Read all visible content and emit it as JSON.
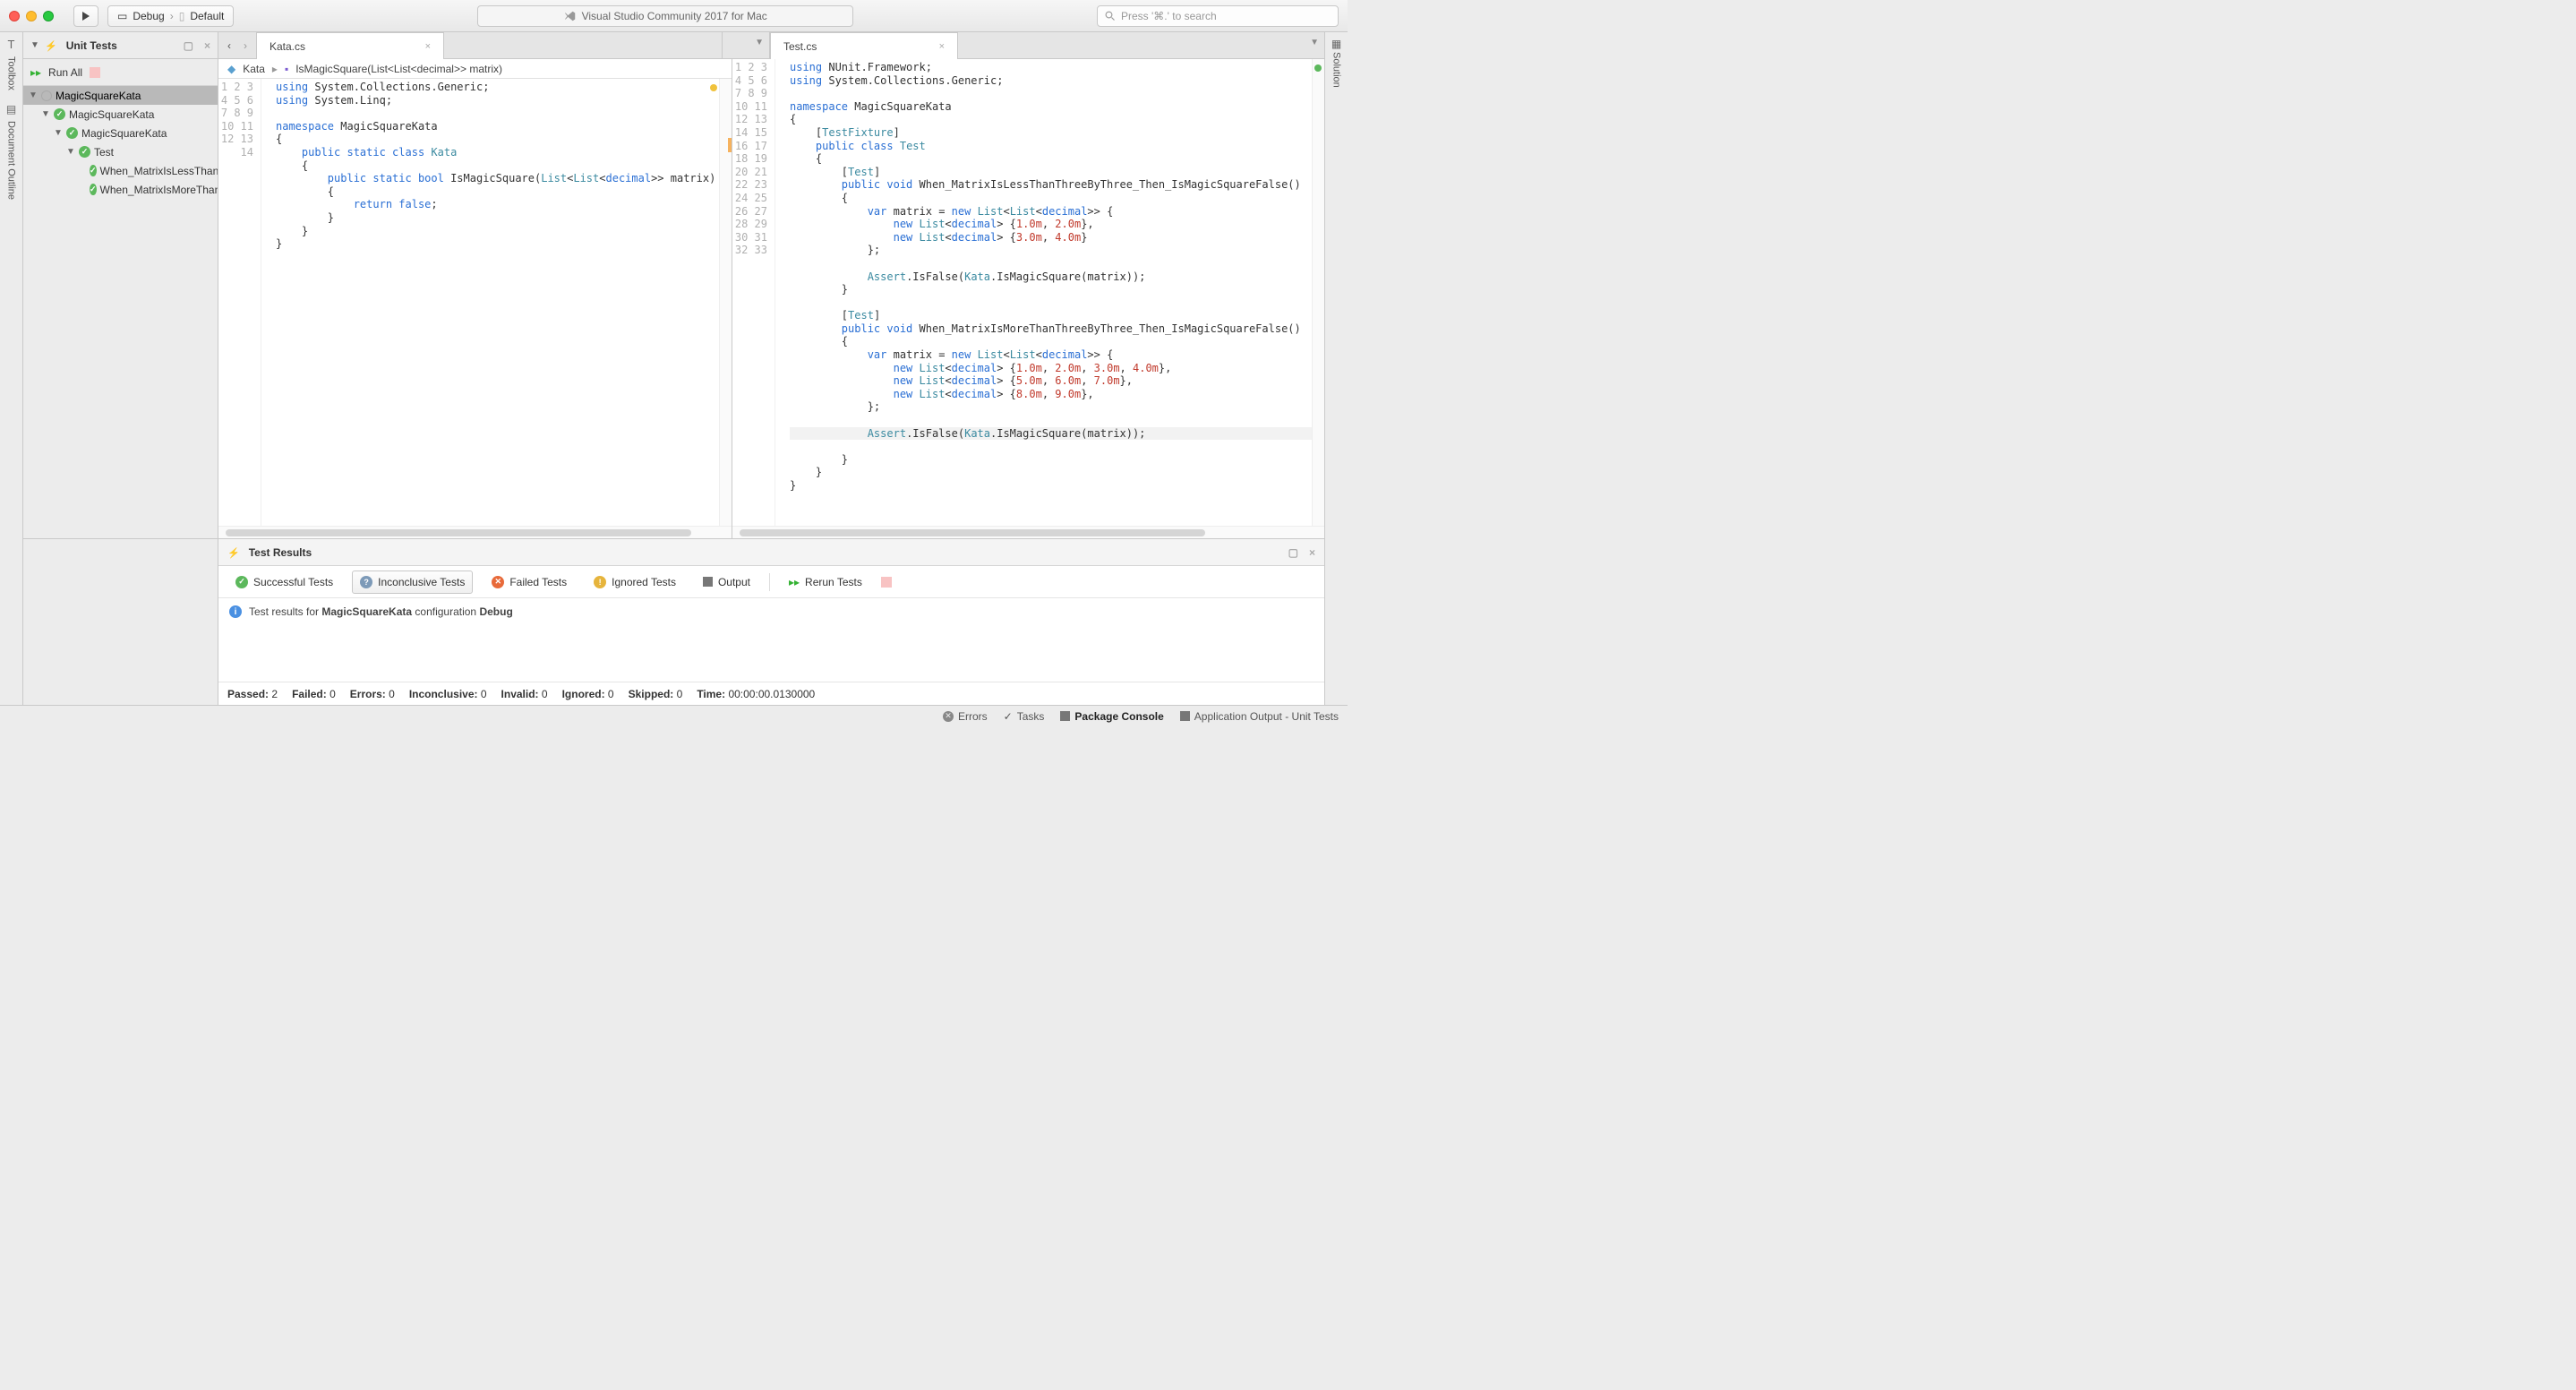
{
  "titlebar": {
    "config": "Debug",
    "target": "Default",
    "app_title": "Visual Studio Community 2017 for Mac",
    "search_placeholder": "Press '⌘.' to search"
  },
  "left_rail": {
    "toolbox": "Toolbox",
    "outline": "Document Outline"
  },
  "right_rail": {
    "solution": "Solution"
  },
  "unit_tests": {
    "title": "Unit Tests",
    "run_all": "Run All",
    "tree": {
      "root": "MagicSquareKata",
      "n0": "MagicSquareKata",
      "n1": "MagicSquareKata",
      "n2": "Test",
      "t1": "When_MatrixIsLessThanThreeByThree_Then_IsMagicSquareFalse",
      "t2": "When_MatrixIsMoreThanThreeByThree_Then_IsMagicSquareFalse"
    }
  },
  "tabs": {
    "left": "Kata.cs",
    "right": "Test.cs"
  },
  "crumb": {
    "c1": "Kata",
    "c2": "IsMagicSquare(List<List<decimal>> matrix)"
  },
  "results": {
    "title": "Test Results",
    "successful": "Successful Tests",
    "inconclusive": "Inconclusive Tests",
    "failed": "Failed Tests",
    "ignored": "Ignored Tests",
    "output": "Output",
    "rerun": "Rerun Tests",
    "info_prefix": "Test results for ",
    "info_bold1": "MagicSquareKata",
    "info_mid": " configuration ",
    "info_bold2": "Debug",
    "summary": {
      "passed_l": "Passed:",
      "passed_v": "2",
      "failed_l": "Failed:",
      "failed_v": "0",
      "errors_l": "Errors:",
      "errors_v": "0",
      "inconclusive_l": "Inconclusive:",
      "inconclusive_v": "0",
      "invalid_l": "Invalid:",
      "invalid_v": "0",
      "ignored_l": "Ignored:",
      "ignored_v": "0",
      "skipped_l": "Skipped:",
      "skipped_v": "0",
      "time_l": "Time:",
      "time_v": "00:00:00.0130000"
    }
  },
  "statusbar": {
    "errors": "Errors",
    "tasks": "Tasks",
    "package": "Package Console",
    "appout": "Application Output - Unit Tests"
  }
}
